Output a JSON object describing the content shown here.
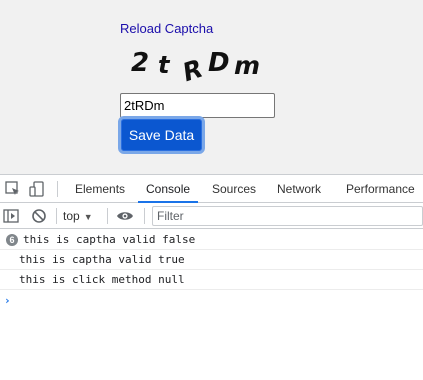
{
  "page": {
    "reload_link": "Reload Captcha",
    "captcha_chars": [
      "2",
      "t",
      "R",
      "D",
      "m"
    ],
    "input_value": "2tRDm",
    "save_button": "Save Data"
  },
  "devtools": {
    "tabs": [
      {
        "label": "Elements",
        "active": false
      },
      {
        "label": "Console",
        "active": true
      },
      {
        "label": "Sources",
        "active": false
      },
      {
        "label": "Network",
        "active": false
      },
      {
        "label": "Performance",
        "active": false
      }
    ],
    "icons": {
      "inspect": "inspect-element-icon",
      "device": "device-toolbar-icon",
      "sidebar": "console-sidebar-icon",
      "clear": "clear-console-icon",
      "eye": "live-expression-eye-icon"
    },
    "toolbar": {
      "context": "top",
      "filter_placeholder": "Filter"
    },
    "messages": [
      {
        "count": "6",
        "text": "this is captha valid false"
      },
      {
        "count": "",
        "text": "this is captha valid true"
      },
      {
        "count": "",
        "text": "this is click method null"
      }
    ],
    "prompt_symbol": "›",
    "accent_color": "#1a73e8"
  }
}
